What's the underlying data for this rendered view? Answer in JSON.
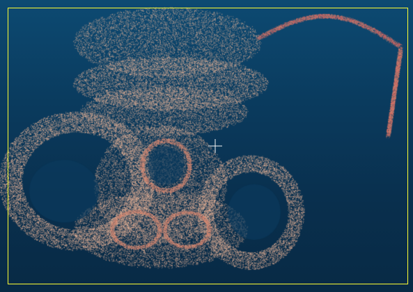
{
  "viewer": {
    "background_color_top": "#0d4a72",
    "background_color_bottom": "#082a45",
    "frame_color": "#ffff33",
    "point_color_primary": "#f0b89a",
    "point_color_secondary": "#d98a73",
    "point_color_highlight": "#ff5a5a"
  },
  "overlay": {
    "crosshair_icon": "crosshair-icon"
  }
}
